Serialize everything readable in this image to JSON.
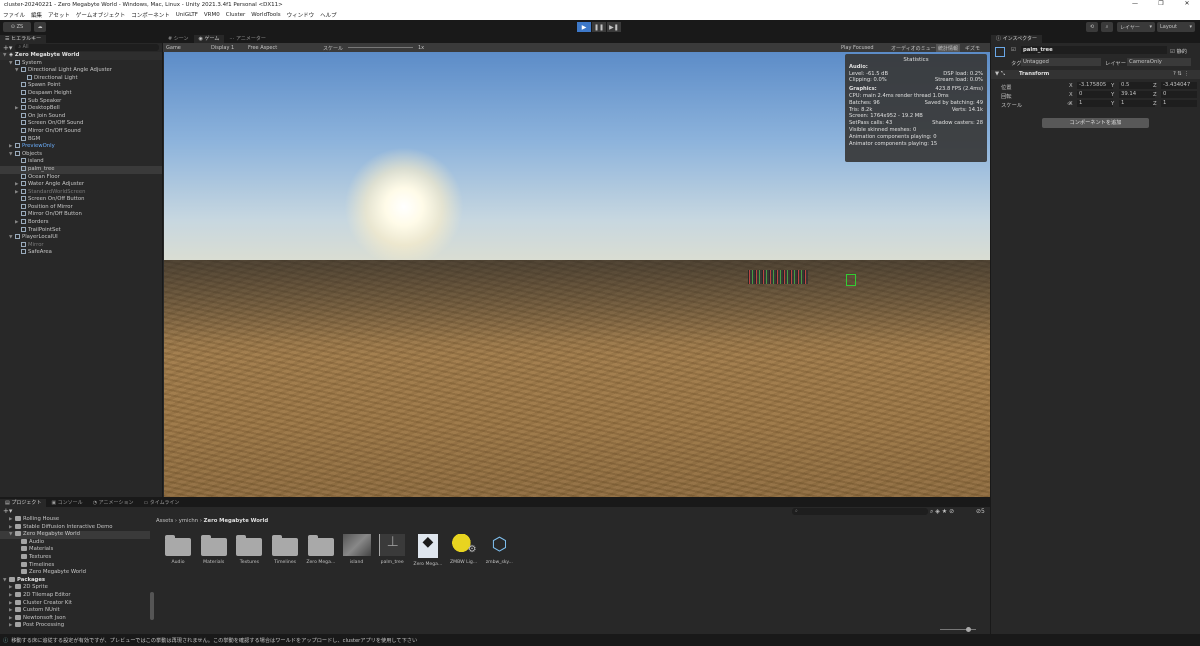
{
  "window": {
    "title": "cluster-20240221 - Zero Megabyte World - Windows, Mac, Linux - Unity 2021.3.4f1 Personal <DX11>",
    "controls": [
      "—",
      "❐",
      "✕"
    ]
  },
  "menu": [
    "ファイル",
    "編集",
    "アセット",
    "ゲームオブジェクト",
    "コンポーネント",
    "UniGLTF",
    "VRM0",
    "Cluster",
    "WorldTools",
    "ウィンドウ",
    "ヘルプ"
  ],
  "toolbar": {
    "account": "ZS",
    "layers": "レイヤー",
    "layout": "Layout",
    "play": "▶",
    "pause": "❚❚",
    "step": "▶❚"
  },
  "hierarchy": {
    "tab": "ヒエラルキー",
    "search_placeholder": "All",
    "scene": "Zero Megabyte World",
    "items": [
      {
        "label": "System",
        "depth": 1,
        "arrow": "▼",
        "cls": ""
      },
      {
        "label": "Directional Light Angle Adjuster",
        "depth": 2,
        "arrow": "▼",
        "cls": ""
      },
      {
        "label": "Directional Light",
        "depth": 3,
        "arrow": "",
        "cls": ""
      },
      {
        "label": "Spawn Point",
        "depth": 2,
        "arrow": "",
        "cls": ""
      },
      {
        "label": "Despawn Height",
        "depth": 2,
        "arrow": "",
        "cls": ""
      },
      {
        "label": "Sub Speaker",
        "depth": 2,
        "arrow": "",
        "cls": ""
      },
      {
        "label": "DesktopBell",
        "depth": 2,
        "arrow": "▶",
        "cls": ""
      },
      {
        "label": "On Join Sound",
        "depth": 2,
        "arrow": "",
        "cls": ""
      },
      {
        "label": "Screen On/Off Sound",
        "depth": 2,
        "arrow": "",
        "cls": ""
      },
      {
        "label": "Mirror On/Off Sound",
        "depth": 2,
        "arrow": "",
        "cls": ""
      },
      {
        "label": "BGM",
        "depth": 2,
        "arrow": "",
        "cls": ""
      },
      {
        "label": "PreviewOnly",
        "depth": 1,
        "arrow": "▶",
        "cls": "blue"
      },
      {
        "label": "Objects",
        "depth": 1,
        "arrow": "▼",
        "cls": ""
      },
      {
        "label": "island",
        "depth": 2,
        "arrow": "",
        "cls": ""
      },
      {
        "label": "palm_tree",
        "depth": 2,
        "arrow": "",
        "cls": "sel"
      },
      {
        "label": "Ocean Floor",
        "depth": 2,
        "arrow": "",
        "cls": ""
      },
      {
        "label": "Water Angle Adjuster",
        "depth": 2,
        "arrow": "▶",
        "cls": ""
      },
      {
        "label": "StandardWorldScreen",
        "depth": 2,
        "arrow": "▶",
        "cls": "dim"
      },
      {
        "label": "Screen On/Off Button",
        "depth": 2,
        "arrow": "",
        "cls": ""
      },
      {
        "label": "Position of Mirror",
        "depth": 2,
        "arrow": "",
        "cls": ""
      },
      {
        "label": "Mirror On/Off Button",
        "depth": 2,
        "arrow": "",
        "cls": ""
      },
      {
        "label": "Borders",
        "depth": 2,
        "arrow": "▶",
        "cls": ""
      },
      {
        "label": "TrailPointSet",
        "depth": 2,
        "arrow": "",
        "cls": ""
      },
      {
        "label": "PlayerLocalUI",
        "depth": 1,
        "arrow": "▼",
        "cls": ""
      },
      {
        "label": "Mirror",
        "depth": 2,
        "arrow": "",
        "cls": "dim"
      },
      {
        "label": "SafeArea",
        "depth": 2,
        "arrow": "",
        "cls": ""
      }
    ]
  },
  "game": {
    "tabs": [
      "シーン",
      "ゲーム",
      "アニメーター"
    ],
    "mode": "Game",
    "display": "Display 1",
    "aspect": "Free Aspect",
    "scale_label": "スケール",
    "scale_value": "1x",
    "play_focused": "Play Focused",
    "mute": "オーディオのミュート",
    "stats_btn": "統計情報",
    "gizmos": "ギズモ",
    "stats": {
      "title": "Statistics",
      "audio": "Audio:",
      "level": "Level: -61.5 dB",
      "clipping": "Clipping: 0.0%",
      "dsp": "DSP load: 0.2%",
      "stream": "Stream load: 0.0%",
      "graphics": "Graphics:",
      "fps": "423.8 FPS (2.4ms)",
      "cpu": "CPU: main 2.4ms  render thread 1.0ms",
      "batches": "Batches: 96",
      "saved": "Saved by batching: 49",
      "tris": "Tris: 8.2k",
      "verts": "Verts: 14.1k",
      "screen": "Screen: 1764x952 - 19.2 MB",
      "setpass": "SetPass calls: 43",
      "shadow": "Shadow casters: 28",
      "skinned": "Visible skinned meshes: 0",
      "anim": "Animation components playing: 0",
      "animator": "Animator components playing: 15"
    }
  },
  "inspector": {
    "tab": "インスペクター",
    "object_name": "palm_tree",
    "static": "静的",
    "tag_label": "タグ",
    "tag": "Untagged",
    "layer_label": "レイヤー",
    "layer": "CameraOnly",
    "transform": "Transform",
    "position_label": "位置",
    "rotation_label": "回転",
    "scale_label": "スケール",
    "pos": {
      "x": "-3.175805",
      "y": "0.5",
      "z": "-3.434047"
    },
    "rot": {
      "x": "0",
      "y": "39.14",
      "z": "0"
    },
    "scl": {
      "x": "1",
      "y": "1",
      "z": "1"
    },
    "add_component": "コンポーネントを追加"
  },
  "project": {
    "tabs": [
      "プロジェクト",
      "コンソール",
      "アニメーション",
      "タイムライン"
    ],
    "breadcrumb": [
      "Assets",
      "ymichn",
      "Zero Megabyte World"
    ],
    "tree": [
      {
        "label": "Rolling House",
        "depth": 1,
        "arrow": "▶"
      },
      {
        "label": "Stable Diffusion Interactive Demo",
        "depth": 1,
        "arrow": "▶"
      },
      {
        "label": "Zero Megabyte World",
        "depth": 1,
        "arrow": "▼"
      },
      {
        "label": "Audio",
        "depth": 2,
        "arrow": ""
      },
      {
        "label": "Materials",
        "depth": 2,
        "arrow": ""
      },
      {
        "label": "Textures",
        "depth": 2,
        "arrow": ""
      },
      {
        "label": "Timelines",
        "depth": 2,
        "arrow": ""
      },
      {
        "label": "Zero Megabyte World",
        "depth": 2,
        "arrow": ""
      }
    ],
    "packages_label": "Packages",
    "packages": [
      "2D Sprite",
      "2D Tilemap Editor",
      "Cluster Creator Kit",
      "Custom NUnit",
      "Newtonsoft Json",
      "Post Processing"
    ],
    "assets": [
      "Audio",
      "Materials",
      "Textures",
      "Timelines",
      "Zero Mega...",
      "island",
      "palm_tree",
      "Zero Mega...",
      "ZMBW Lig...",
      "zmbw_sky..."
    ],
    "hidden_count": "5"
  },
  "status": "移動する床に追従する設定が有効ですが、プレビューではこの挙動は再現されません。この挙動を確認する場合はワールドをアップロードし、clusterアプリを使用して下さい"
}
